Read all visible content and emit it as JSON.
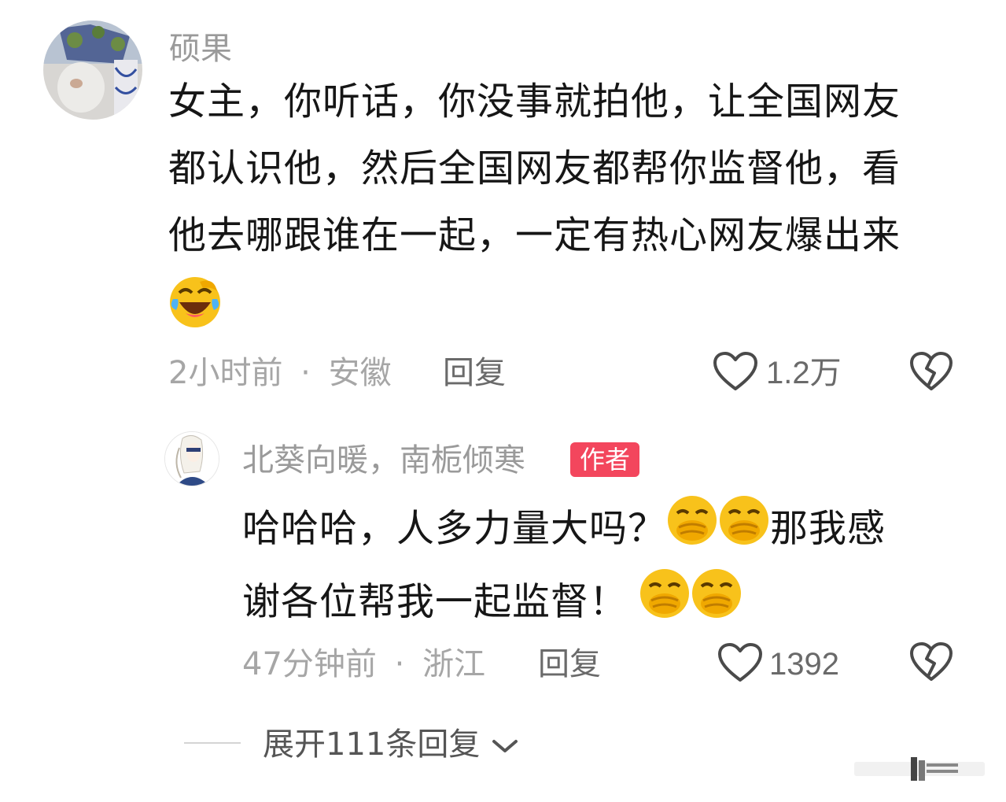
{
  "comment": {
    "username": "硕果",
    "text_lines": [
      "女主，你听话，你没事就拍他，让全国网友",
      "都认识他，然后全国网友都帮你监督他，看",
      "他去哪跟谁在一起，一定有热心网友爆出来"
    ],
    "emoji": "laughing-crying-emoji",
    "time": "2小时前",
    "location": "安徽",
    "separator": "·",
    "reply_label": "回复",
    "like_count": "1.2万"
  },
  "reply": {
    "username": "北葵向暖，南栀倾寒",
    "author_badge": "作者",
    "line1_a": "哈哈哈，人多力量大吗？",
    "line1_b": "那我感",
    "line2": "谢各位帮我一起监督！",
    "emoji": "hand-over-mouth-emoji",
    "time": "47分钟前",
    "location": "浙江",
    "separator": "·",
    "reply_label": "回复",
    "like_count": "1392"
  },
  "expand": {
    "label": "展开111条回复"
  },
  "colors": {
    "author_badge": "#f3465d",
    "username": "#9a9a9a",
    "emoji_yellow": "#f8c21b"
  }
}
